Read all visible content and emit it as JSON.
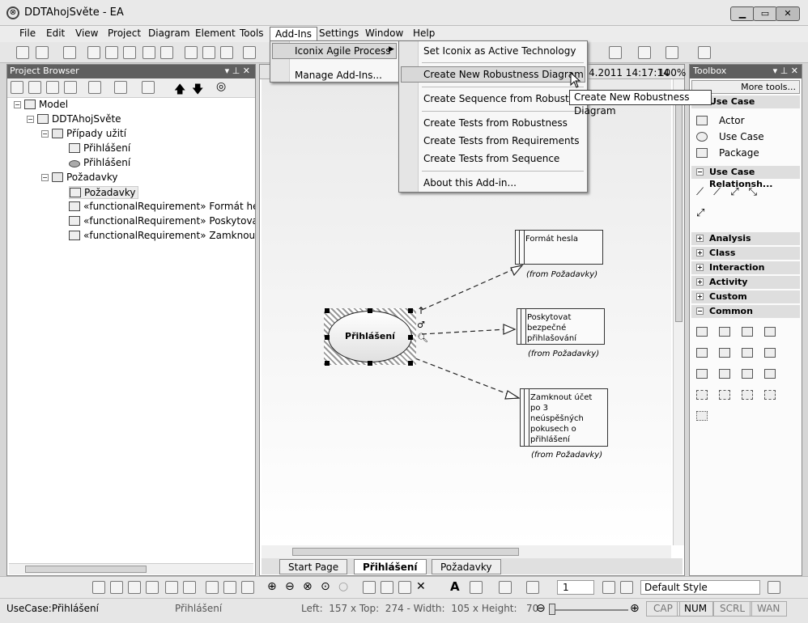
{
  "window": {
    "title": "DDTAhojSvěte - EA"
  },
  "menubar": [
    "File",
    "Edit",
    "View",
    "Project",
    "Diagram",
    "Element",
    "Tools",
    "Add-Ins",
    "Settings",
    "Window",
    "Help"
  ],
  "addins_menu": {
    "items": [
      "Iconix Agile Process",
      "Manage Add-Ins..."
    ]
  },
  "iconix_submenu": {
    "items": [
      "Set Iconix as Active Technology",
      "Create New Robustness Diagram",
      "Create Sequence from Robustness",
      "Create Tests from Robustness",
      "Create Tests from Requirements",
      "Create Tests from Sequence",
      "About this Add-in..."
    ]
  },
  "tooltip": "Create New Robustness Diagram",
  "diagram_header": {
    "date": "4.2011 14:17:14",
    "zoom": "100%"
  },
  "project_browser": {
    "title": "Project Browser",
    "tree": [
      {
        "label": "Model"
      },
      {
        "label": "DDTAhojSvěte"
      },
      {
        "label": "Případy užití"
      },
      {
        "label": "Přihlášení"
      },
      {
        "label": "Přihlášení"
      },
      {
        "label": "Požadavky"
      },
      {
        "label": "Požadavky"
      },
      {
        "label": "«functionalRequirement» Formát hesla"
      },
      {
        "label": "«functionalRequirement» Poskytovat be"
      },
      {
        "label": "«functionalRequirement» Zamknout úč"
      }
    ]
  },
  "diagram": {
    "usecase": "Přihlášení",
    "requirements": [
      {
        "text": "Formát hesla",
        "from": "(from Požadavky)"
      },
      {
        "text": "Poskytovat bezpečné přihlašování",
        "from": "(from Požadavky)"
      },
      {
        "text": "Zamknout účet po 3 neúspěšných pokusech o přihlášení",
        "from": "(from Požadavky)"
      }
    ],
    "tabs": [
      "Start Page",
      "Přihlášení",
      "Požadavky"
    ]
  },
  "toolbox": {
    "title": "Toolbox",
    "more_tools": "More tools...",
    "sections": {
      "use_case": "Use Case",
      "use_case_items": [
        "Actor",
        "Use Case",
        "Package"
      ],
      "relationships": "Use Case Relationsh...",
      "analysis": "Analysis",
      "class": "Class",
      "interaction": "Interaction",
      "activity": "Activity",
      "custom": "Custom",
      "common": "Common"
    }
  },
  "toolbar2": {
    "line_width": "1",
    "style": "Default Style"
  },
  "status": {
    "element": "UseCase:Přihlášení",
    "name": "Přihlášení",
    "geometry": "Left:  157 x Top:  274 - Width:  105 x Height:   70",
    "indicators": [
      "CAP",
      "NUM",
      "SCRL",
      "WAN"
    ]
  }
}
